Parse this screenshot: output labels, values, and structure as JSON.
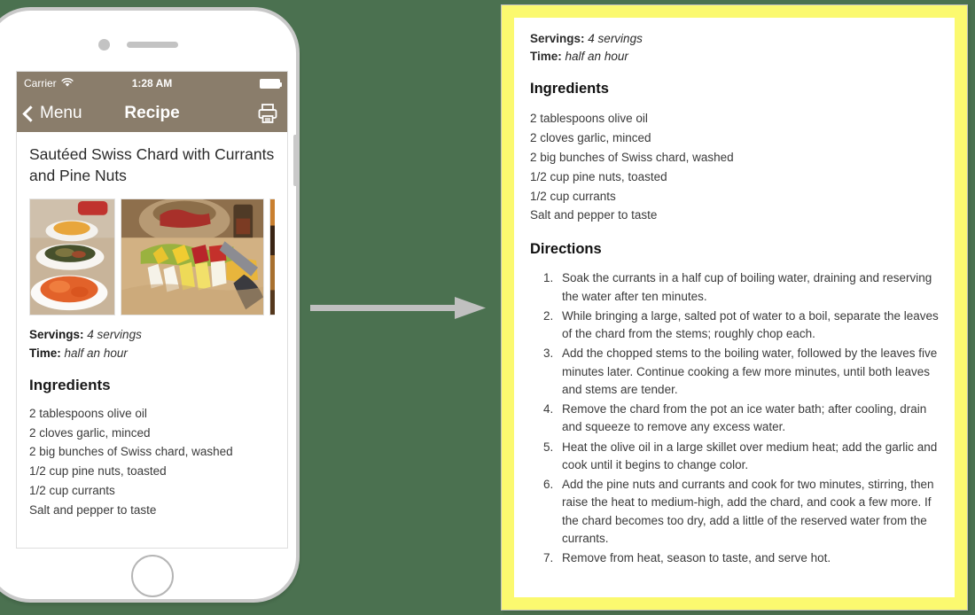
{
  "background_color": "#4b7150",
  "phone": {
    "status_bar": {
      "carrier": "Carrier",
      "wifi_icon": "wifi-icon",
      "time": "1:28 AM",
      "battery_icon": "battery-full-icon",
      "bar_color": "#8a7d6b"
    },
    "nav_bar": {
      "back_label": "Menu",
      "back_icon": "chevron-left-icon",
      "title": "Recipe",
      "print_icon": "printer-icon"
    },
    "content": {
      "recipe_title": "Sautéed Swiss Chard with Currants and Pine Nuts",
      "photos": [
        {
          "name": "photo-bowls-of-food"
        },
        {
          "name": "photo-chopped-vegetables-cutting-board"
        },
        {
          "name": "photo-partial-next"
        }
      ],
      "servings_label": "Servings:",
      "servings_value": "4 servings",
      "time_label": "Time:",
      "time_value": "half an hour",
      "ingredients_heading": "Ingredients",
      "ingredients": [
        "2 tablespoons olive oil",
        "2 cloves garlic, minced",
        "2 big bunches of Swiss chard, washed",
        "1/2 cup pine nuts, toasted",
        "1/2 cup currants",
        "Salt and pepper to taste"
      ]
    }
  },
  "arrow": {
    "name": "flow-arrow-right",
    "color": "#c0c0c0"
  },
  "document": {
    "border_color": "#fbf96f",
    "servings_label": "Servings:",
    "servings_value": "4 servings",
    "time_label": "Time:",
    "time_value": "half an hour",
    "ingredients_heading": "Ingredients",
    "ingredients": [
      "2 tablespoons olive oil",
      "2 cloves garlic, minced",
      "2 big bunches of Swiss chard, washed",
      "1/2 cup pine nuts, toasted",
      "1/2 cup currants",
      "Salt and pepper to taste"
    ],
    "directions_heading": "Directions",
    "directions": [
      "Soak the currants in a half cup of boiling water, draining and reserving the water after ten minutes.",
      "While bringing a large, salted pot of water to a boil, separate the leaves of the chard from the stems; roughly chop each.",
      "Add the chopped stems to the boiling water, followed by the leaves five minutes later. Continue cooking a few more minutes, until both leaves and stems are tender.",
      "Remove the chard from the pot an ice water bath; after cooling, drain and squeeze to remove any excess water.",
      "Heat the olive oil in a large skillet over medium heat; add the garlic and cook until it begins to change color.",
      "Add the pine nuts and currants and cook for two minutes, stirring, then raise the heat to medium-high, add the chard, and cook a few more. If the chard becomes too dry, add a little of the reserved water from the currants.",
      "Remove from heat, season to taste, and serve hot."
    ]
  }
}
